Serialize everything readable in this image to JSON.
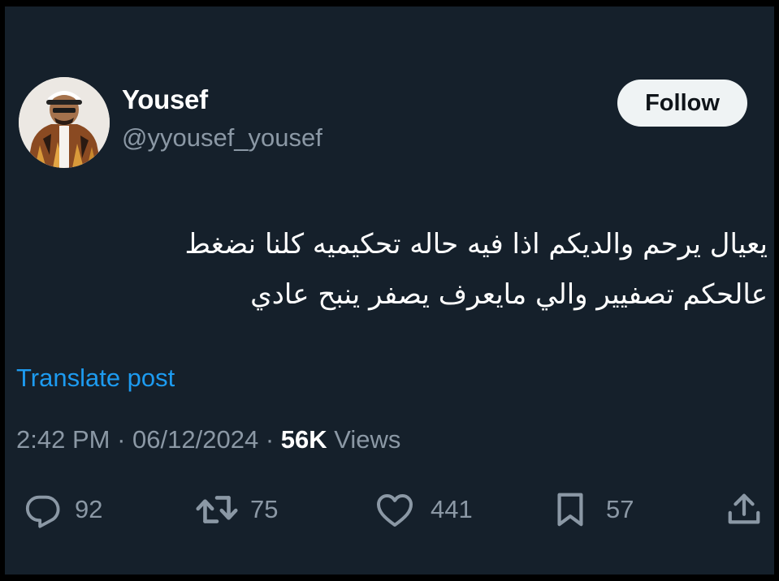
{
  "user": {
    "display_name": "Yousef",
    "handle": "@yyousef_yousef",
    "avatar_icon": "profile-photo"
  },
  "follow_label": "Follow",
  "tweet": {
    "lines": [
      "يعيال يرحم والديكم اذا فيه حاله تحكيميه كلنا نضغط",
      "عالحكم تصفيير والي مايعرف يصفر ينبح عادي"
    ]
  },
  "translate_label": "Translate post",
  "meta": {
    "time": "2:42 PM",
    "separator": "·",
    "date": "06/12/2024",
    "views_count": "56K",
    "views_label": "Views"
  },
  "actions": {
    "reply": {
      "icon": "reply-icon",
      "count": "92"
    },
    "repost": {
      "icon": "repost-icon",
      "count": "75"
    },
    "like": {
      "icon": "heart-icon",
      "count": "441"
    },
    "bookmark": {
      "icon": "bookmark-icon",
      "count": "57"
    },
    "share": {
      "icon": "share-icon"
    }
  },
  "colors": {
    "background": "#15202b",
    "text": "#ffffff",
    "secondary": "#8b98a5",
    "link": "#1d9bf0",
    "button_bg": "#eff3f4"
  }
}
